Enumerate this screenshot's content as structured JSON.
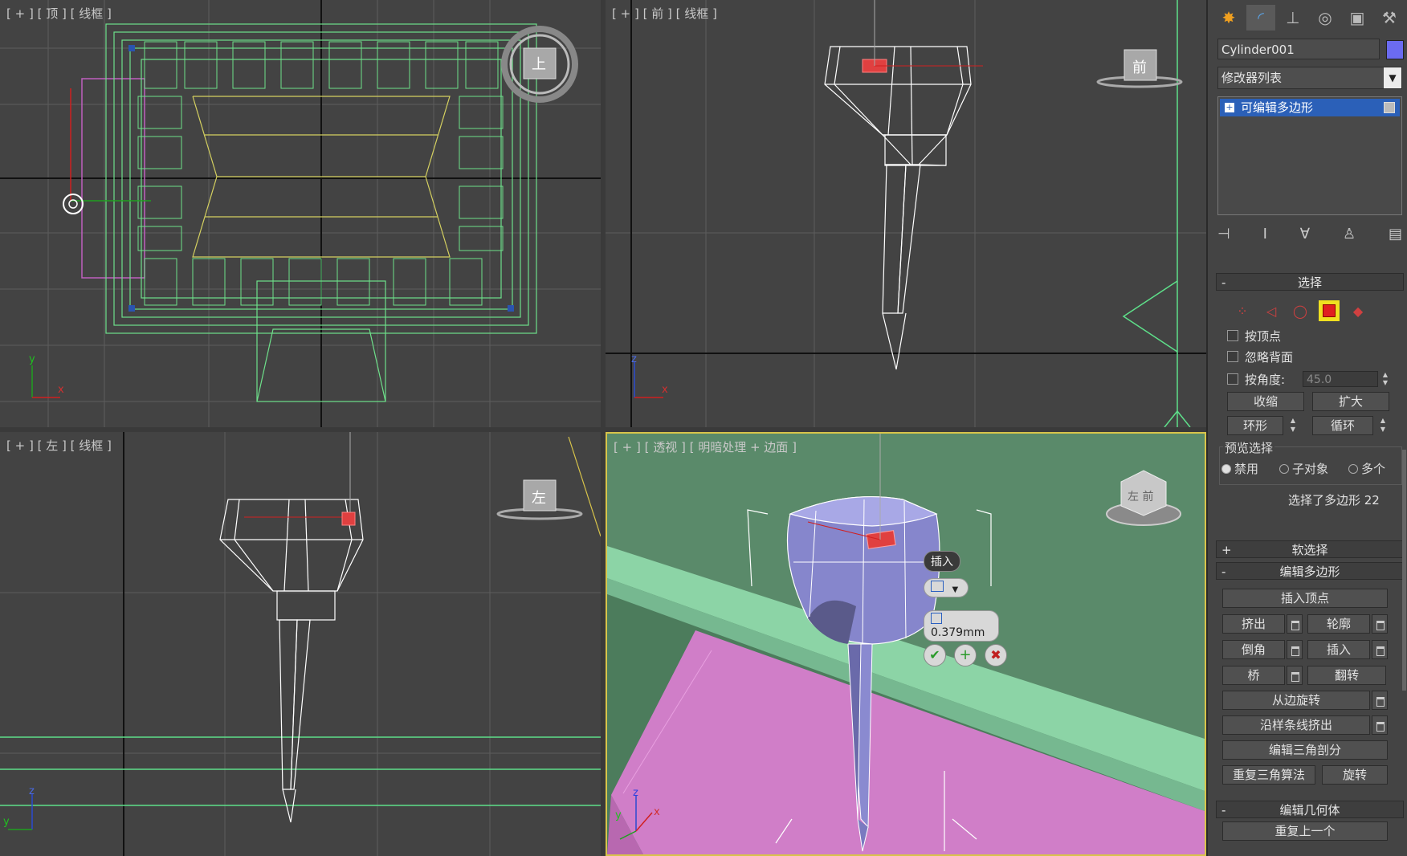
{
  "viewports": {
    "top": {
      "label": "[ + ] [ 顶 ] [ 线框 ]",
      "cube_label": "上"
    },
    "front": {
      "label": "[ + ] [ 前 ] [ 线框 ]",
      "cube_label": "前"
    },
    "left": {
      "label": "[ + ] [ 左 ] [ 线框 ]",
      "cube_label": "左"
    },
    "perspective": {
      "label": "[ + ] [ 透视 ] [ 明暗处理 + 边面 ]",
      "cube_label": "左 前"
    }
  },
  "axes": {
    "x": "x",
    "y": "y",
    "z": "z"
  },
  "caddy": {
    "title": "插入",
    "value": "0.379mm",
    "ok_icon": "check-icon",
    "apply_icon": "plus-icon",
    "cancel_icon": "x-icon"
  },
  "panel": {
    "tabs": [
      "create-icon",
      "modify-icon",
      "hierarchy-icon",
      "motion-icon",
      "display-icon",
      "utilities-icon"
    ],
    "object_name": "Cylinder001",
    "object_color": "#6b6bf0",
    "modifier_list": "修改器列表",
    "stack_item": "可编辑多边形",
    "selection": {
      "title": "选择",
      "sign": "-",
      "by_vertex": "按顶点",
      "ignore_backfacing": "忽略背面",
      "by_angle": "按角度:",
      "angle_value": "45.0",
      "shrink": "收缩",
      "grow": "扩大",
      "ring": "环形",
      "loop": "循环",
      "preview_group": "预览选择",
      "preview_off": "禁用",
      "preview_subobj": "子对象",
      "preview_multi": "多个",
      "status": "选择了多边形 22"
    },
    "soft_selection": {
      "title": "软选择",
      "sign": "+"
    },
    "edit_polygons": {
      "title": "编辑多边形",
      "sign": "-",
      "insert_vertex": "插入顶点",
      "extrude": "挤出",
      "outline": "轮廓",
      "bevel": "倒角",
      "inset": "插入",
      "bridge": "桥",
      "flip": "翻转",
      "hinge_from_edge": "从边旋转",
      "extrude_along_spline": "沿样条线挤出",
      "edit_triangulation": "编辑三角剖分",
      "retriangulate": "重复三角算法",
      "turn": "旋转"
    },
    "edit_geometry": {
      "title": "编辑几何体",
      "sign": "-",
      "repeat_last": "重复上一个"
    }
  }
}
